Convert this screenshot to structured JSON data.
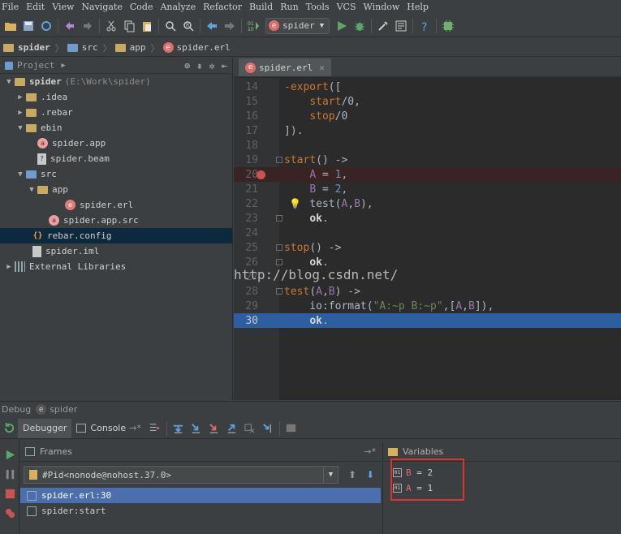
{
  "menu": [
    "File",
    "Edit",
    "View",
    "Navigate",
    "Code",
    "Analyze",
    "Refactor",
    "Build",
    "Run",
    "Tools",
    "VCS",
    "Window",
    "Help"
  ],
  "toolbar": {
    "run_config": "spider"
  },
  "breadcrumb": [
    "spider",
    "src",
    "app",
    "spider.erl"
  ],
  "project": {
    "header": "Project",
    "tree": [
      {
        "label": "spider",
        "extra": "(E:\\Work\\spider)"
      },
      {
        "label": ".idea"
      },
      {
        "label": ".rebar"
      },
      {
        "label": "ebin"
      },
      {
        "label": "spider.app"
      },
      {
        "label": "spider.beam"
      },
      {
        "label": "src"
      },
      {
        "label": "app"
      },
      {
        "label": "spider.erl"
      },
      {
        "label": "spider.app.src"
      },
      {
        "label": "rebar.config"
      },
      {
        "label": "spider.iml"
      },
      {
        "label": "External Libraries"
      }
    ]
  },
  "editor": {
    "tab": "spider.erl",
    "line_numbers": [
      "14",
      "15",
      "16",
      "17",
      "18",
      "19",
      "20",
      "21",
      "22",
      "23",
      "24",
      "25",
      "26",
      "27",
      "28",
      "29",
      "30"
    ],
    "watermark": "http://blog.csdn.net/"
  },
  "debug": {
    "title": "Debug",
    "config": "spider",
    "tabs": [
      "Debugger",
      "Console"
    ],
    "frames_header": "Frames",
    "process": "#Pid<nonode@nohost.37.0>",
    "frames": [
      "spider.erl:30",
      "spider:start"
    ],
    "variables_header": "Variables",
    "variables": [
      {
        "name": "B",
        "value": "= 2"
      },
      {
        "name": "A",
        "value": "= 1"
      }
    ]
  }
}
